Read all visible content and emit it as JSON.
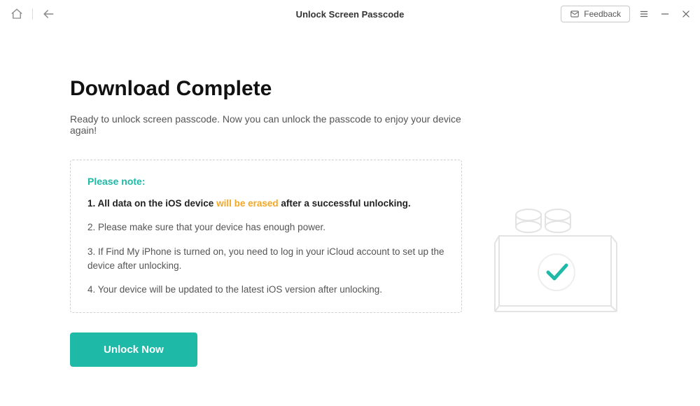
{
  "titlebar": {
    "title": "Unlock Screen Passcode",
    "feedback_label": "Feedback"
  },
  "main": {
    "heading": "Download Complete",
    "subheading": "Ready to unlock screen passcode. Now you can unlock the passcode to enjoy your device again!"
  },
  "note": {
    "head": "Please note:",
    "item1_before": "1. All data on the iOS device ",
    "item1_highlight": "will be erased",
    "item1_after": " after a successful unlocking.",
    "item2": "2. Please make sure that your device has enough power.",
    "item3": "3. If Find My iPhone is turned on, you need to log in your iCloud account to set up the device after unlocking.",
    "item4": "4. Your device will be updated to the latest iOS version after unlocking."
  },
  "buttons": {
    "unlock": "Unlock Now"
  },
  "colors": {
    "accent": "#1fb9a8",
    "warn": "#f5a623"
  }
}
